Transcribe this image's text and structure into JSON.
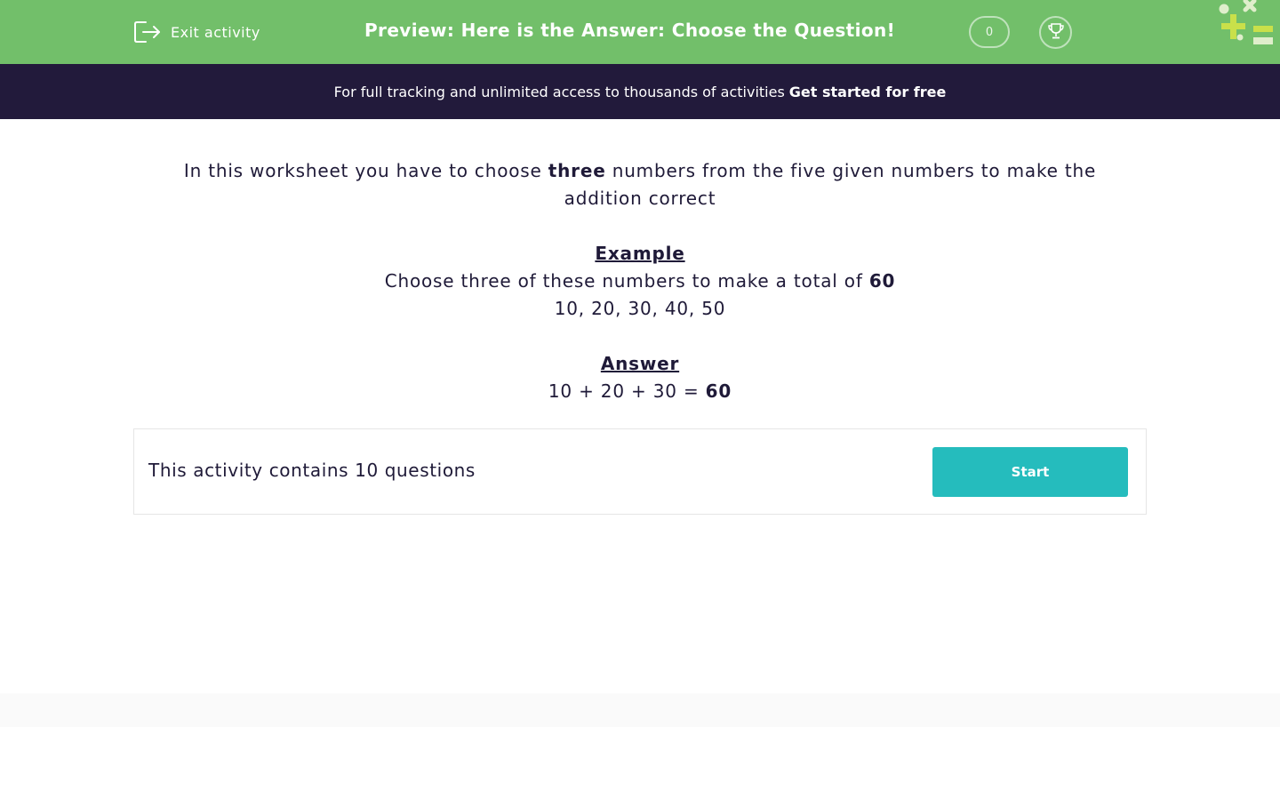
{
  "header": {
    "exit_label": "Exit activity",
    "title": "Preview: Here is the Answer: Choose the Question!",
    "score": "0"
  },
  "promo": {
    "text": "For full tracking and unlimited access to thousands of activities",
    "cta": "Get started for free"
  },
  "intro": {
    "before": "In this worksheet you have to choose ",
    "emphasis": "three",
    "after": " numbers from the five given numbers to make the addition correct"
  },
  "example": {
    "heading": "Example",
    "line_prefix": "Choose three of these numbers to make a total of ",
    "total": "60",
    "numbers": "10, 20, 30, 40, 50"
  },
  "answer": {
    "heading": "Answer",
    "equation_prefix": "10 + 20 + 30 = ",
    "result": "60"
  },
  "activity": {
    "info": "This activity contains 10 questions",
    "start_label": "Start"
  },
  "colors": {
    "header_green": "#72bf6a",
    "promo_dark": "#221a3b",
    "start_teal": "#25bcbd",
    "text_dark": "#1f1a38"
  },
  "icons": [
    "exit-icon",
    "trophy-icon",
    "maths-symbols-decoration"
  ]
}
